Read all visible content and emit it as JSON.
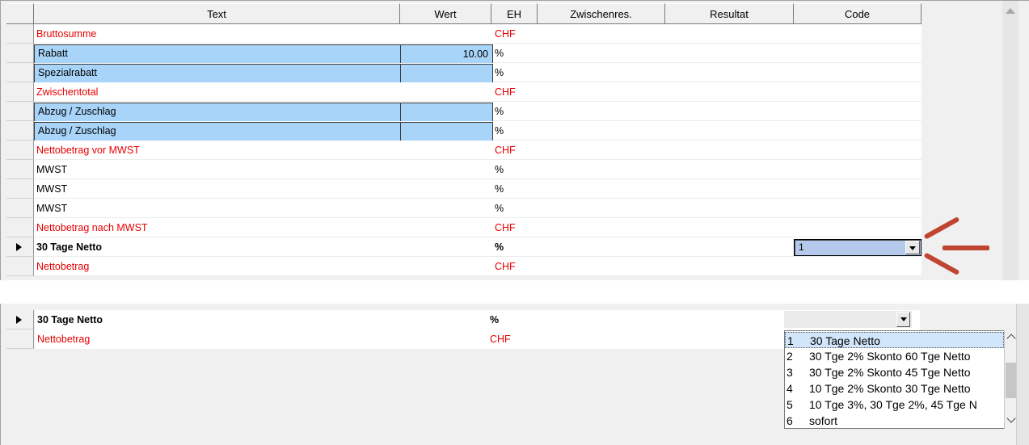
{
  "columns": [
    "Text",
    "Wert",
    "EH",
    "Zwischenres.",
    "Resultat",
    "Code"
  ],
  "rows": [
    {
      "text": "Bruttosumme",
      "wert": "",
      "eh": "CHF",
      "style": "red"
    },
    {
      "text": "Rabatt",
      "wert": "10.00",
      "eh": "%",
      "style": "input"
    },
    {
      "text": "Spezialrabatt",
      "wert": "",
      "eh": "%",
      "style": "input"
    },
    {
      "text": "Zwischentotal",
      "wert": "",
      "eh": "CHF",
      "style": "red"
    },
    {
      "text": "Abzug / Zuschlag",
      "wert": "",
      "eh": "%",
      "style": "input"
    },
    {
      "text": "Abzug / Zuschlag",
      "wert": "",
      "eh": "%",
      "style": "input"
    },
    {
      "text": "Nettobetrag vor MWST",
      "wert": "",
      "eh": "CHF",
      "style": "red"
    },
    {
      "text": "MWST",
      "wert": "",
      "eh": "%",
      "style": "normal"
    },
    {
      "text": "MWST",
      "wert": "",
      "eh": "%",
      "style": "normal"
    },
    {
      "text": "MWST",
      "wert": "",
      "eh": "%",
      "style": "normal"
    },
    {
      "text": "Nettobetrag nach MWST",
      "wert": "",
      "eh": "CHF",
      "style": "red"
    },
    {
      "text": "30 Tage Netto",
      "wert": "",
      "eh": "%",
      "style": "bold"
    },
    {
      "text": "Nettobetrag",
      "wert": "",
      "eh": "CHF",
      "style": "red"
    }
  ],
  "code_combo": {
    "value": "1"
  },
  "bottom_rows": [
    {
      "text": "30 Tage Netto",
      "eh": "%",
      "style": "bold"
    },
    {
      "text": "Nettobetrag",
      "eh": "CHF",
      "style": "red"
    }
  ],
  "code_options": [
    {
      "key": "1",
      "label": "30 Tage Netto"
    },
    {
      "key": "2",
      "label": "30 Tge 2% Skonto 60 Tge Netto"
    },
    {
      "key": "3",
      "label": "30 Tge 2% Skonto 45 Tge Netto"
    },
    {
      "key": "4",
      "label": "10 Tge 2% Skonto 30 Tge Netto"
    },
    {
      "key": "5",
      "label": "10 Tge 3%, 30 Tge 2%, 45 Tge N"
    },
    {
      "key": "6",
      "label": "sofort"
    }
  ],
  "colors": {
    "accent_red": "#e60000",
    "input_blue": "#a9d4f9",
    "callout_arrow": "#c0442f"
  }
}
